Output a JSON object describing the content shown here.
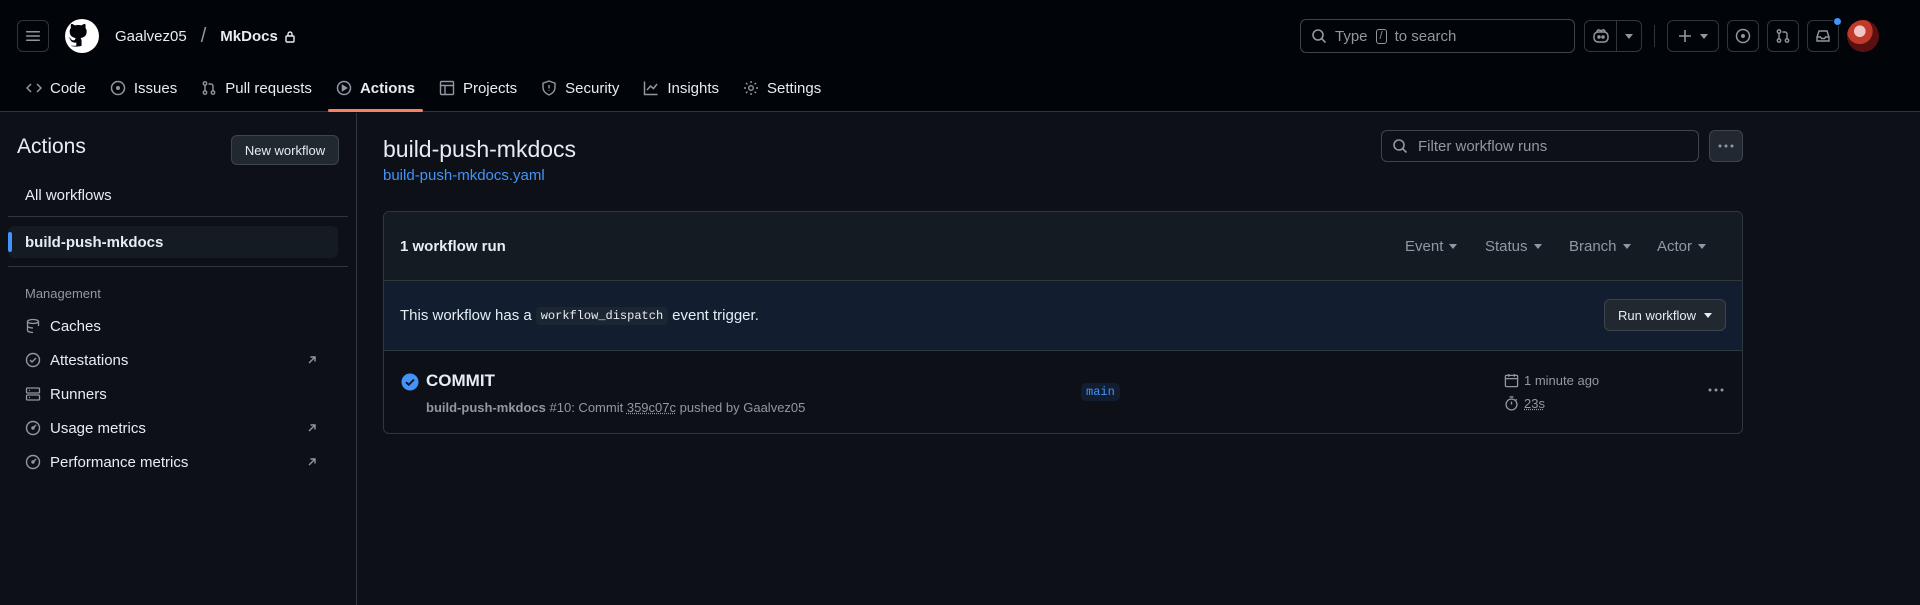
{
  "header": {
    "owner": "Gaalvez05",
    "separator": "/",
    "repo": "MkDocs",
    "search_type": "Type",
    "search_key": "/",
    "search_rest": "to search"
  },
  "tabs": [
    {
      "label": "Code",
      "icon": "code-icon"
    },
    {
      "label": "Issues",
      "icon": "issue-opened-icon"
    },
    {
      "label": "Pull requests",
      "icon": "git-pull-request-icon"
    },
    {
      "label": "Actions",
      "icon": "play-icon"
    },
    {
      "label": "Projects",
      "icon": "table-icon"
    },
    {
      "label": "Security",
      "icon": "shield-icon"
    },
    {
      "label": "Insights",
      "icon": "graph-icon"
    },
    {
      "label": "Settings",
      "icon": "gear-icon"
    }
  ],
  "sidebar": {
    "title": "Actions",
    "new_workflow": "New workflow",
    "all_workflows": "All workflows",
    "selected_workflow": "build-push-mkdocs",
    "management_heading": "Management",
    "items": [
      {
        "label": "Caches",
        "icon": "database-icon"
      },
      {
        "label": "Attestations",
        "icon": "verified-icon"
      },
      {
        "label": "Runners",
        "icon": "server-icon"
      },
      {
        "label": "Usage metrics",
        "icon": "meter-icon"
      },
      {
        "label": "Performance metrics",
        "icon": "meter-icon"
      }
    ]
  },
  "main": {
    "title": "build-push-mkdocs",
    "file_link": "build-push-mkdocs.yaml",
    "filter_placeholder": "Filter workflow runs",
    "run_count": "1 workflow run",
    "filters": [
      "Event",
      "Status",
      "Branch",
      "Actor"
    ],
    "notice_prefix": "This workflow has a",
    "notice_code": "workflow_dispatch",
    "notice_suffix": "event trigger.",
    "run_workflow": "Run workflow",
    "run": {
      "title": "COMMIT",
      "workflow": "build-push-mkdocs",
      "detail_prefix": "#10: Commit",
      "sha": "359c07c",
      "detail_suffix": "pushed by Gaalvez05",
      "branch": "main",
      "time_ago": "1 minute ago",
      "duration": "23s",
      "status": "success"
    }
  },
  "colors": {
    "accent": "#4493f8",
    "active_tab": "#f78166",
    "background": "#0d1117"
  }
}
